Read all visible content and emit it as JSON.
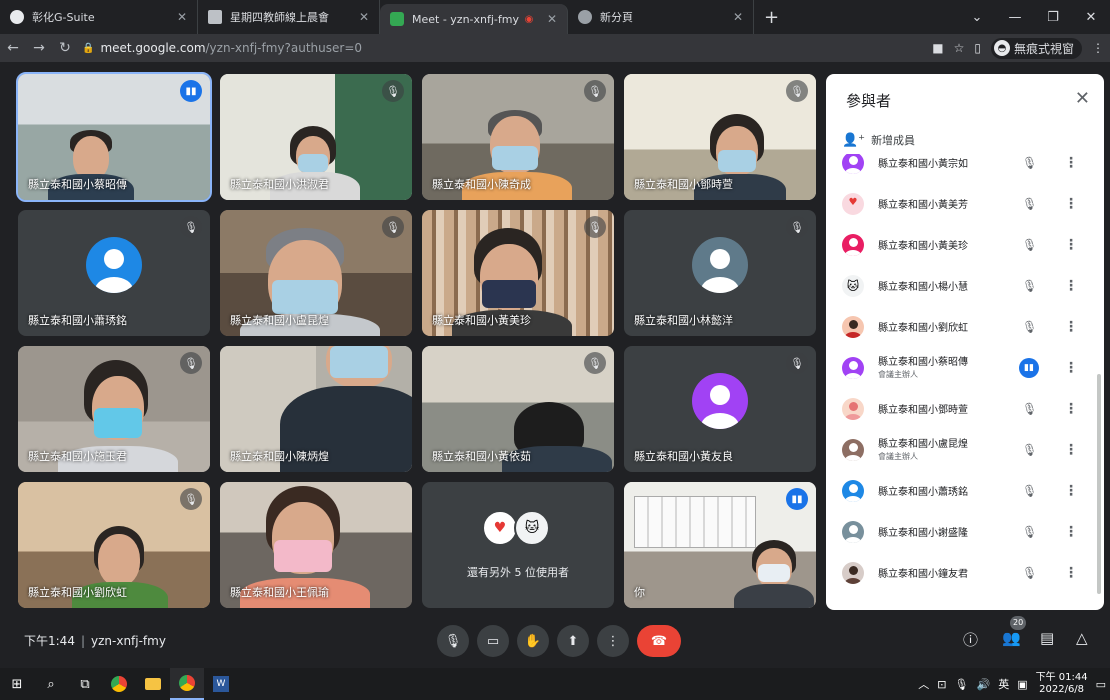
{
  "browser": {
    "tabs": [
      {
        "title": "彰化G-Suite",
        "color": "#e8eaed"
      },
      {
        "title": "星期四教師線上晨會",
        "color": "#bdc1c6"
      },
      {
        "title": "Meet - yzn-xnfj-fmy",
        "color": "#34a853",
        "active": true
      },
      {
        "title": "新分頁",
        "color": "#9aa0a6"
      }
    ],
    "url_host": "meet.google.com",
    "url_path": "/yzn-xnfj-fmy?authuser=0",
    "incognito_label": "無痕式視窗"
  },
  "tiles": [
    {
      "name": "縣立泰和國小蔡昭傳",
      "state": "talk"
    },
    {
      "name": "縣立泰和國小洪淑君",
      "state": "mute"
    },
    {
      "name": "縣立泰和國小陳奇成",
      "state": "mute"
    },
    {
      "name": "縣立泰和國小鄧時萱",
      "state": "mute"
    },
    {
      "name": "縣立泰和國小蕭琇銘",
      "state": "mute",
      "avatar": "#1e88e5"
    },
    {
      "name": "縣立泰和國小盧昆煌",
      "state": "mute"
    },
    {
      "name": "縣立泰和國小黃美珍",
      "state": "mute"
    },
    {
      "name": "縣立泰和國小林懿洋",
      "state": "mute",
      "avatar": "#5f7a8a"
    },
    {
      "name": "縣立泰和國小施玉君",
      "state": "mute"
    },
    {
      "name": "縣立泰和國小陳炳煌",
      "state": "none"
    },
    {
      "name": "縣立泰和國小黃依茹",
      "state": "mute"
    },
    {
      "name": "縣立泰和國小黃友良",
      "state": "mute",
      "avatar": "#a142f4"
    },
    {
      "name": "縣立泰和國小劉欣虹",
      "state": "mute"
    },
    {
      "name": "縣立泰和國小王佩瑜",
      "state": "none"
    },
    {
      "name": "",
      "state": "more"
    },
    {
      "name": "你",
      "state": "talk"
    }
  ],
  "more_users_text": "還有另外 5 位使用者",
  "panel": {
    "title": "參與者",
    "add_member": "新增成員",
    "participants": [
      {
        "name": "縣立泰和國小黃宗如",
        "color": "#a142f4",
        "mic": "off"
      },
      {
        "name": "縣立泰和國小黃美芳",
        "color": "#f9d9e0",
        "mic": "off"
      },
      {
        "name": "縣立泰和國小黃美珍",
        "color": "#e91e63",
        "mic": "off"
      },
      {
        "name": "縣立泰和國小楊小慧",
        "color": "#f1f3f4",
        "mic": "off"
      },
      {
        "name": "縣立泰和國小劉欣虹",
        "color": "#f6c6b0",
        "mic": "off"
      },
      {
        "name": "縣立泰和國小蔡昭傳",
        "sub": "會議主辦人",
        "color": "#a142f4",
        "mic": "on"
      },
      {
        "name": "縣立泰和國小鄧時萱",
        "color": "#f8d7c8",
        "mic": "off"
      },
      {
        "name": "縣立泰和國小盧昆煌",
        "sub": "會議主辦人",
        "color": "#8d6e63",
        "mic": "off"
      },
      {
        "name": "縣立泰和國小蕭琇銘",
        "color": "#1e88e5",
        "mic": "off"
      },
      {
        "name": "縣立泰和國小謝盛隆",
        "color": "#78909c",
        "mic": "off"
      },
      {
        "name": "縣立泰和國小鐘友君",
        "color": "#d7ccc8",
        "mic": "off"
      }
    ]
  },
  "control": {
    "time": "下午1:44",
    "separator": "|",
    "code": "yzn-xnfj-fmy",
    "participant_count": "20"
  },
  "taskbar": {
    "tray_lang": "英",
    "clock_time": "下午 01:44",
    "clock_date": "2022/6/8"
  }
}
